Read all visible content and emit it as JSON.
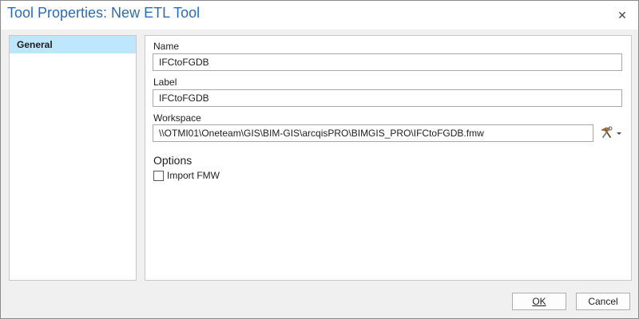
{
  "window": {
    "title": "Tool Properties: New ETL Tool",
    "close_icon": "close-icon"
  },
  "nav": {
    "items": [
      {
        "label": "General",
        "selected": true
      }
    ]
  },
  "general": {
    "name": {
      "label": "Name",
      "value": "IFCtoFGDB"
    },
    "label_field": {
      "label": "Label",
      "value": "IFCtoFGDB"
    },
    "workspace": {
      "label": "Workspace",
      "value": "\\\\OTMI01\\Oneteam\\GIS\\BIM-GIS\\arcqisPRO\\BIMGIS_PRO\\IFCtoFGDB.fmw",
      "browse_icon": "hammer-wrench-icon",
      "dropdown_icon": "chevron-down-icon"
    },
    "options": {
      "header": "Options",
      "import_fmw": {
        "label": "Import FMW",
        "checked": false
      }
    }
  },
  "footer": {
    "ok_label": "OK",
    "cancel_label": "Cancel"
  },
  "colors": {
    "title": "#2a6cb5",
    "nav_selected": "#bee6fd",
    "dialog_bg": "#f0f0f0"
  }
}
